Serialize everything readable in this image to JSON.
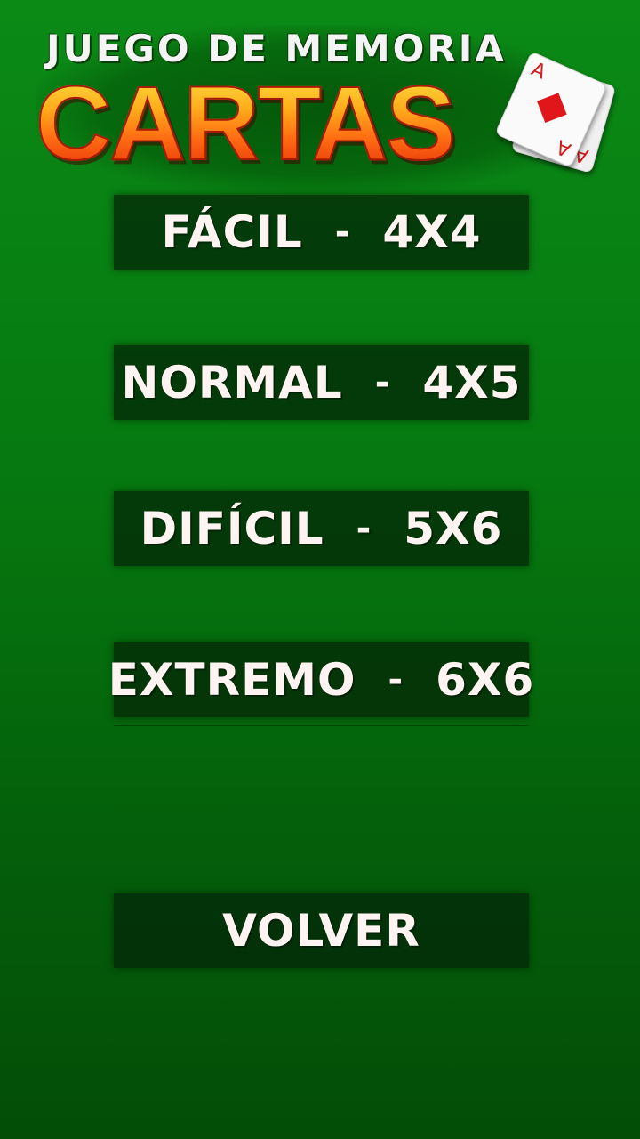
{
  "logo": {
    "subtitle": "JUEGO DE MEMORIA",
    "title": "CARTAS",
    "card_rank": "A"
  },
  "menu": {
    "items": [
      {
        "name": "FÁCIL",
        "sep": "-",
        "size": "4X4"
      },
      {
        "name": "NORMAL",
        "sep": "-",
        "size": "4X5"
      },
      {
        "name": "DIFÍCIL",
        "sep": "-",
        "size": "5X6"
      },
      {
        "name": "EXTREMO",
        "sep": "-",
        "size": "6X6"
      }
    ],
    "back_label": "VOLVER"
  },
  "colors": {
    "background": "#0b8a16",
    "button_bg": "#04280a",
    "title_gradient_top": "#ffe040",
    "title_gradient_bottom": "#e22c0a",
    "card_suit": "#e0161a"
  },
  "icons": [
    "diamond-suit-icon"
  ]
}
